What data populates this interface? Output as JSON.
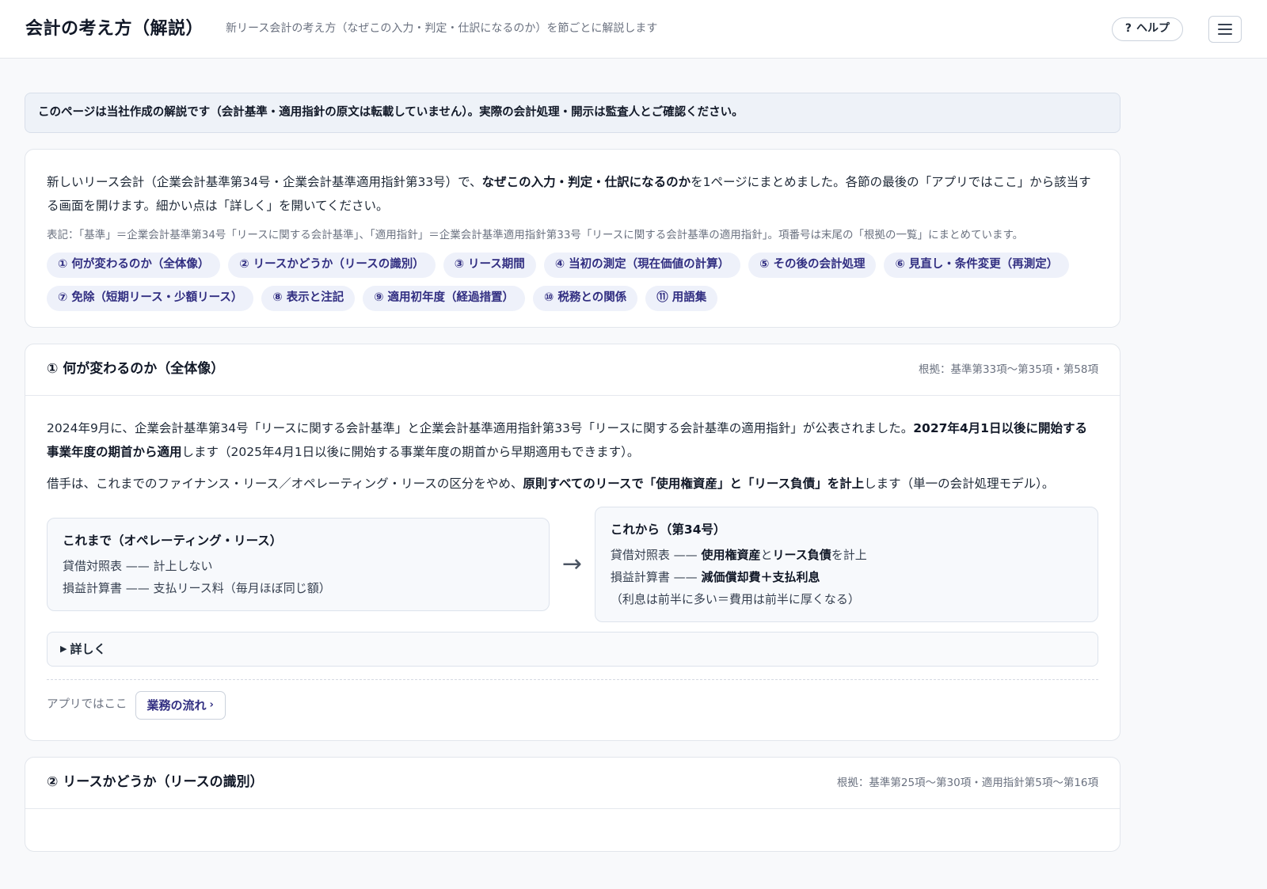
{
  "header": {
    "title": "会計の考え方（解説）",
    "subtitle": "新リース会計の考え方（なぜこの入力・判定・仕訳になるのか）を節ごとに解説します",
    "help_icon": "?",
    "help_label": "ヘルプ",
    "menu_icon": "hamburger-icon"
  },
  "notice": {
    "text": "このページは当社作成の解説です（会計基準・適用指針の原文は転載していません）。実際の会計処理・開示は監査人とご確認ください。"
  },
  "intro": {
    "text_1": "新しいリース会計（企業会計基準第34号・企業会計基準適用指針第33号）で、",
    "text_bold": "なぜこの入力・判定・仕訳になるのか",
    "text_2": "を1ページにまとめました。各節の最後の「アプリではここ」から該当する画面を開けます。細かい点は「詳しく」を開いてください。",
    "note": "表記：「基準」＝企業会計基準第34号「リースに関する会計基準」、「適用指針」＝企業会計基準適用指針第33号「リースに関する会計基準の適用指針」。項番号は末尾の「根拠の一覧」にまとめています。",
    "toc": [
      "① 何が変わるのか（全体像）",
      "② リースかどうか（リースの識別）",
      "③ リース期間",
      "④ 当初の測定（現在価値の計算）",
      "⑤ その後の会計処理",
      "⑥ 見直し・条件変更（再測定）",
      "⑦ 免除（短期リース・少額リース）",
      "⑧ 表示と注記",
      "⑨ 適用初年度（経過措置）",
      "⑩ 税務との関係",
      "⑪ 用語集"
    ]
  },
  "section1": {
    "title": "① 何が変わるのか（全体像）",
    "basis": "根拠：基準第33項〜第35項・第58項",
    "p1_a": "2024年9月に、企業会計基準第34号「リースに関する会計基準」と企業会計基準適用指針第33号「リースに関する会計基準の適用指針」が公表されました。",
    "p1_bold": "2027年4月1日以後に開始する事業年度の期首から適用",
    "p1_b": "します（2025年4月1日以後に開始する事業年度の期首から早期適用もできます）。",
    "p2_a": "借手は、これまでのファイナンス・リース／オペレーティング・リースの区分をやめ、",
    "p2_bold": "原則すべてのリースで「使用権資産」と「リース負債」を計上",
    "p2_b": "します（単一の会計処理モデル）。",
    "before": {
      "title": "これまで（オペレーティング・リース）",
      "line1": "貸借対照表 —— 計上しない",
      "line2": "損益計算書 —— 支払リース料（毎月ほぼ同じ額）"
    },
    "arrow": "→",
    "after": {
      "title": "これから（第34号）",
      "l1_a": "貸借対照表 —— ",
      "l1_b1": "使用権資産",
      "l1_c": "と",
      "l1_b2": "リース負債",
      "l1_d": "を計上",
      "l2_a": "損益計算書 —— ",
      "l2_b": "減価償却費＋支払利息",
      "l3": "（利息は前半に多い＝費用は前半に厚くなる）"
    },
    "details_label": "詳しく",
    "details_marker": "▶",
    "app_label": "アプリではここ",
    "app_button": "業務の流れ",
    "app_chevron": "›"
  },
  "section2": {
    "title": "② リースかどうか（リースの識別）",
    "basis": "根拠：基準第25項〜第30項・適用指針第5項〜第16項"
  }
}
